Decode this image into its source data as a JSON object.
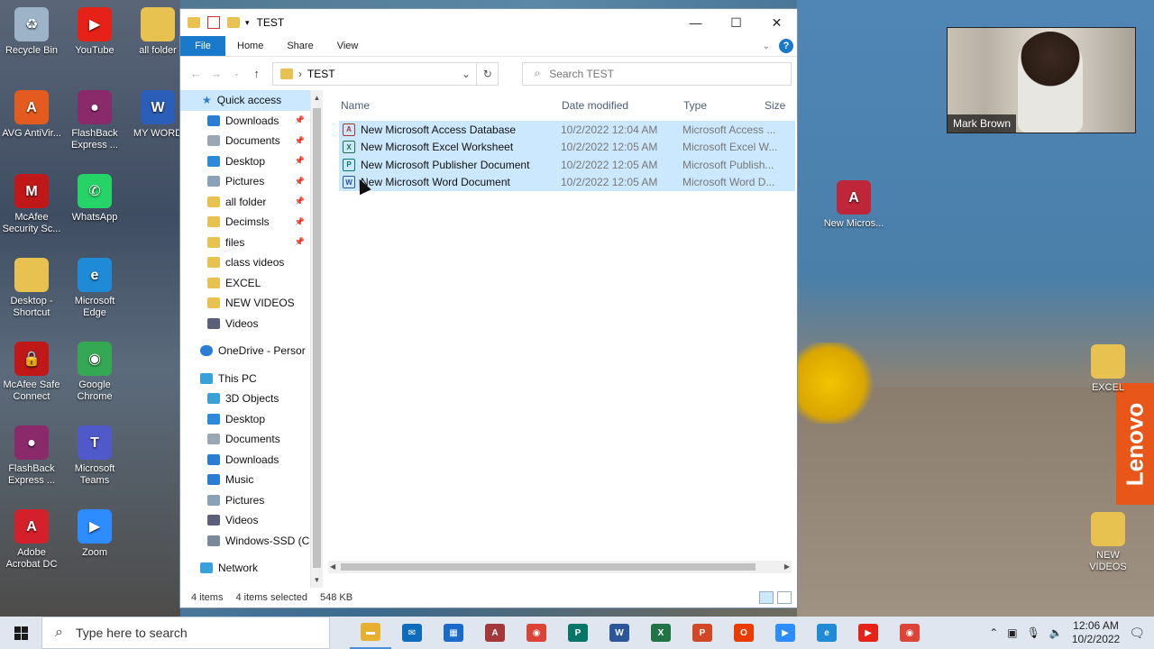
{
  "desktop": {
    "left_icons": [
      {
        "label": "Recycle Bin",
        "color": "#9db3c8",
        "glyph": "♻"
      },
      {
        "label": "YouTube",
        "color": "#e62117",
        "glyph": "▶"
      },
      {
        "label": "all folder",
        "color": "#e8c250",
        "glyph": ""
      },
      {
        "label": "AVG AntiVir...",
        "color": "#e35b1e",
        "glyph": "A"
      },
      {
        "label": "FlashBack Express ...",
        "color": "#8a2a6b",
        "glyph": "●"
      },
      {
        "label": "MY WORD",
        "color": "#2b5eb8",
        "glyph": "W"
      },
      {
        "label": "McAfee Security Sc...",
        "color": "#c01818",
        "glyph": "M"
      },
      {
        "label": "WhatsApp",
        "color": "#25d366",
        "glyph": "✆"
      },
      {
        "label": "Desktop - Shortcut",
        "color": "#e8c250",
        "glyph": ""
      },
      {
        "label": "Microsoft Edge",
        "color": "#1f8ad6",
        "glyph": "e"
      },
      {
        "label": "McAfee Safe Connect",
        "color": "#c01818",
        "glyph": "🔒"
      },
      {
        "label": "Google Chrome",
        "color": "#34a853",
        "glyph": "◉"
      },
      {
        "label": "FlashBack Express ...",
        "color": "#8a2a6b",
        "glyph": "●"
      },
      {
        "label": "Microsoft Teams",
        "color": "#5059c9",
        "glyph": "T"
      },
      {
        "label": "Adobe Acrobat DC",
        "color": "#d4202a",
        "glyph": "A"
      },
      {
        "label": "Zoom",
        "color": "#2d8cff",
        "glyph": "▶"
      }
    ],
    "right_icons": [
      {
        "label": "New Micros...",
        "color": "#c0263a",
        "glyph": "A"
      },
      {
        "label": "EXCEL",
        "color": "#e8c250",
        "glyph": ""
      },
      {
        "label": "NEW VIDEOS",
        "color": "#e8c250",
        "glyph": ""
      }
    ],
    "brand": "Lenovo"
  },
  "window": {
    "title": "TEST",
    "controls": {
      "minimize": "—",
      "maximize": "☐",
      "close": "✕"
    },
    "ribbon": {
      "file": "File",
      "tabs": [
        "Home",
        "Share",
        "View"
      ],
      "help": "?"
    },
    "address": {
      "path": "TEST",
      "separator": "›"
    },
    "search": {
      "placeholder": "Search TEST"
    },
    "nav": {
      "quick_access": "Quick access",
      "quick_items": [
        {
          "label": "Downloads",
          "color": "#2b7cd3",
          "pinned": true
        },
        {
          "label": "Documents",
          "color": "#9aa7b5",
          "pinned": true
        },
        {
          "label": "Desktop",
          "color": "#2b8ad9",
          "pinned": true
        },
        {
          "label": "Pictures",
          "color": "#8aa2b8",
          "pinned": true
        },
        {
          "label": "all folder",
          "color": "#e8c250",
          "pinned": true
        },
        {
          "label": "Decimsls",
          "color": "#e8c250",
          "pinned": true
        },
        {
          "label": "files",
          "color": "#e8c250",
          "pinned": true
        },
        {
          "label": "class videos",
          "color": "#e8c250",
          "pinned": false
        },
        {
          "label": "EXCEL",
          "color": "#e8c250",
          "pinned": false
        },
        {
          "label": "NEW VIDEOS",
          "color": "#e8c250",
          "pinned": false
        },
        {
          "label": "Videos",
          "color": "#5b5f7a",
          "pinned": false
        }
      ],
      "onedrive": "OneDrive - Persor",
      "this_pc": "This PC",
      "pc_items": [
        {
          "label": "3D Objects",
          "color": "#3aa0d8"
        },
        {
          "label": "Desktop",
          "color": "#2b8ad9"
        },
        {
          "label": "Documents",
          "color": "#9aa7b5"
        },
        {
          "label": "Downloads",
          "color": "#2b7cd3"
        },
        {
          "label": "Music",
          "color": "#2b7cd3"
        },
        {
          "label": "Pictures",
          "color": "#8aa2b8"
        },
        {
          "label": "Videos",
          "color": "#5b5f7a"
        },
        {
          "label": "Windows-SSD (C",
          "color": "#7a8a9a"
        }
      ],
      "network": "Network"
    },
    "columns": {
      "name": "Name",
      "date": "Date modified",
      "type": "Type",
      "size": "Size"
    },
    "files": [
      {
        "name": "New Microsoft Access Database",
        "date": "10/2/2022 12:04 AM",
        "type": "Microsoft Access ...",
        "badge": "A",
        "color": "#a4373a"
      },
      {
        "name": "New Microsoft Excel Worksheet",
        "date": "10/2/2022 12:05 AM",
        "type": "Microsoft Excel W...",
        "badge": "X",
        "color": "#217346"
      },
      {
        "name": "New Microsoft Publisher Document",
        "date": "10/2/2022 12:05 AM",
        "type": "Microsoft Publish...",
        "badge": "P",
        "color": "#077568"
      },
      {
        "name": "New Microsoft Word Document",
        "date": "10/2/2022 12:05 AM",
        "type": "Microsoft Word D...",
        "badge": "W",
        "color": "#2b579a"
      }
    ],
    "status": {
      "count": "4 items",
      "selected": "4 items selected",
      "size": "548 KB"
    }
  },
  "webcam": {
    "name": "Mark Brown"
  },
  "taskbar": {
    "search_placeholder": "Type here to search",
    "apps": [
      {
        "name": "file-explorer",
        "glyph": "▬",
        "color": "#e8b030",
        "active": true
      },
      {
        "name": "mail",
        "glyph": "✉",
        "color": "#0f6cbd",
        "active": false
      },
      {
        "name": "store",
        "glyph": "▦",
        "color": "#1b6ac9",
        "active": false
      },
      {
        "name": "access",
        "glyph": "A",
        "color": "#a4373a",
        "active": false
      },
      {
        "name": "chrome",
        "glyph": "◉",
        "color": "#db4437",
        "active": false
      },
      {
        "name": "publisher",
        "glyph": "P",
        "color": "#077568",
        "active": false
      },
      {
        "name": "word",
        "glyph": "W",
        "color": "#2b579a",
        "active": false
      },
      {
        "name": "excel",
        "glyph": "X",
        "color": "#217346",
        "active": false
      },
      {
        "name": "powerpoint",
        "glyph": "P",
        "color": "#d24726",
        "active": false
      },
      {
        "name": "office",
        "glyph": "O",
        "color": "#eb3c00",
        "active": false
      },
      {
        "name": "zoom",
        "glyph": "▶",
        "color": "#2d8cff",
        "active": false
      },
      {
        "name": "edge",
        "glyph": "e",
        "color": "#1f8ad6",
        "active": false
      },
      {
        "name": "youtube",
        "glyph": "▶",
        "color": "#e62117",
        "active": false
      },
      {
        "name": "chrome-2",
        "glyph": "◉",
        "color": "#db4437",
        "active": false
      }
    ],
    "time": "12:06 AM",
    "date": "10/2/2022"
  }
}
